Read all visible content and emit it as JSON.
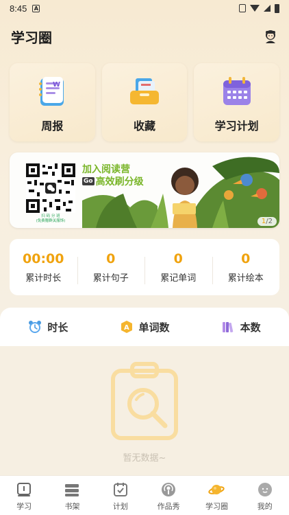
{
  "status_bar": {
    "time": "8:45",
    "notif_letter": "A"
  },
  "header": {
    "title": "学习圈"
  },
  "cards": [
    {
      "label": "周报",
      "icon": "report-icon"
    },
    {
      "label": "收藏",
      "icon": "favorites-icon"
    },
    {
      "label": "学习计划",
      "icon": "calendar-icon"
    }
  ],
  "banner": {
    "line1": "加入阅读营",
    "go": "Go",
    "line2": "高效刷分级",
    "qr_caption1": "扫 码 分 班",
    "qr_caption2": "(免费赠群关服饰)",
    "pager_current": "1",
    "pager_total": "/2"
  },
  "stats": [
    {
      "value": "00:00",
      "label": "累计时长"
    },
    {
      "value": "0",
      "label": "累计句子"
    },
    {
      "value": "0",
      "label": "累记单词"
    },
    {
      "value": "0",
      "label": "累计绘本"
    }
  ],
  "tabs": [
    {
      "label": "时长",
      "icon": "alarm-clock-icon"
    },
    {
      "label": "单词数",
      "icon": "letter-a-icon"
    },
    {
      "label": "本数",
      "icon": "books-icon"
    }
  ],
  "empty": {
    "text": "暂无数据~"
  },
  "nav": [
    {
      "label": "学习",
      "icon": "study-icon"
    },
    {
      "label": "书架",
      "icon": "bookshelf-icon"
    },
    {
      "label": "计划",
      "icon": "plan-icon"
    },
    {
      "label": "作品秀",
      "icon": "podcast-icon"
    },
    {
      "label": "学习圈",
      "icon": "planet-icon",
      "active": true
    },
    {
      "label": "我的",
      "icon": "profile-icon"
    }
  ],
  "colors": {
    "accent": "#f0a30f",
    "banner_green": "#7ab62a",
    "background": "#f6efe2"
  }
}
